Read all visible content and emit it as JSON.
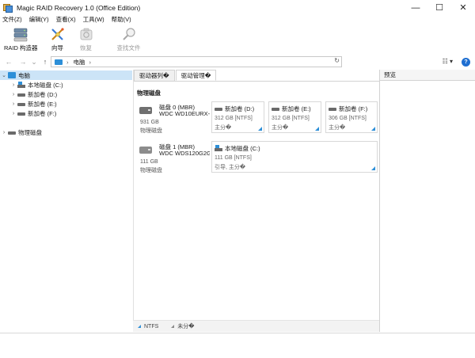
{
  "window": {
    "title": "Magic RAID Recovery 1.0 (Office Edition)",
    "minimize": "—",
    "maximize": "☐",
    "close": "✕"
  },
  "menu": [
    "文件(Z)",
    "编辑(Y)",
    "查看(X)",
    "工具(W)",
    "帮助(V)"
  ],
  "toolbar": {
    "raid": "RAID 构造器",
    "wizard": "向导",
    "recover": "恢复",
    "find": "查找文件"
  },
  "address": {
    "back": "←",
    "forward": "→",
    "dropdown": "⌄",
    "up": "↑",
    "path": "电脑",
    "sep": "›",
    "end_sep": "›",
    "refresh": "↻",
    "help": "?"
  },
  "tree": {
    "root": "电脑",
    "items": [
      "本地磁盘 (C:)",
      "新加卷 (D:)",
      "新加卷 (E:)",
      "新加卷 (F:)"
    ],
    "physical": "物理磁盘"
  },
  "tabs": [
    "驱动器列�",
    "驱动管理�"
  ],
  "section_title": "物理磁盘",
  "disks": [
    {
      "name": "磁盘 0 (MBR)",
      "model": "WDC WD10EURX-63",
      "size": "931 GB",
      "type": "物理磁盘",
      "volumes": [
        {
          "name": "新加卷 (D:)",
          "size": "312 GB [NTFS]",
          "type": "主分�"
        },
        {
          "name": "新加卷 (E:)",
          "size": "312 GB [NTFS]",
          "type": "主分�"
        },
        {
          "name": "新加卷 (F:)",
          "size": "306 GB [NTFS]",
          "type": "主分�"
        }
      ]
    },
    {
      "name": "磁盘 1 (MBR)",
      "model": "WDC WDS120G2G0A",
      "size": "111 GB",
      "type": "物理磁盘",
      "volumes": [
        {
          "name": "本地磁盘 (C:)",
          "size": "111 GB [NTFS]",
          "type": "引导, 主分�"
        }
      ]
    }
  ],
  "legend": [
    "NTFS",
    "未分�"
  ],
  "preview": "预览",
  "colors": {
    "accent": "#2d8fd8",
    "selection": "#cce4f7"
  }
}
